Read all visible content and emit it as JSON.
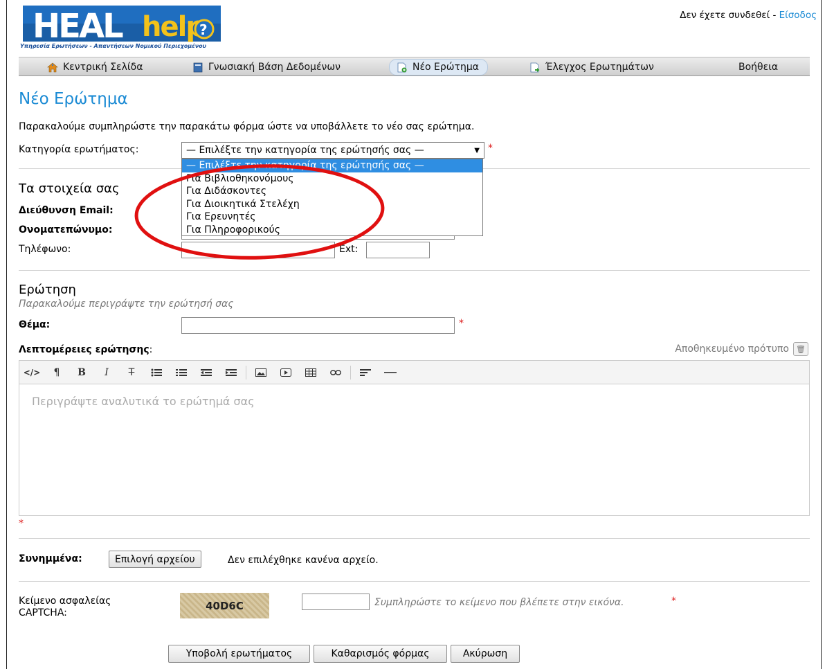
{
  "header": {
    "logo_text": "HEAL help",
    "logo_subtitle": "Υπηρεσία Ερωτήσεων - Απαντήσεων Νομικού Περιεχομένου",
    "login_status": "Δεν έχετε συνδεθεί - ",
    "login_link": "Είσοδος"
  },
  "nav": {
    "items": [
      {
        "label": "Κεντρική Σελίδα",
        "icon": "home-icon"
      },
      {
        "label": "Γνωσιακή Βάση Δεδομένων",
        "icon": "knowledge-base-icon"
      },
      {
        "label": "Νέο Ερώτημα",
        "icon": "new-ticket-icon",
        "active": true
      },
      {
        "label": "Έλεγχος Ερωτημάτων",
        "icon": "check-ticket-icon"
      },
      {
        "label": "Βοήθεια"
      }
    ]
  },
  "page": {
    "title": "Νέο Ερώτημα",
    "intro": "Παρακαλούμε συμπληρώστε την παρακάτω φόρμα ώστε να υποβάλλετε το νέο σας ερώτημα."
  },
  "category": {
    "label": "Κατηγορία ερωτήματος:",
    "selected": "— Επιλέξτε την κατηγορία της ερώτησής σας —",
    "options": [
      "— Επιλέξτε την κατηγορία της ερώτησής σας —",
      "Για Βιβλιοθηκονόμους",
      "Για Διδάσκοντες",
      "Για Διοικητικά Στελέχη",
      "Για Ερευνητές",
      "Για Πληροφορικούς"
    ],
    "required_mark": "*"
  },
  "contact": {
    "heading": "Τα στοιχεία σας",
    "email_label": "Διεύθυνση Email:",
    "name_label": "Ονοματεπώνυμο:",
    "phone_label": "Τηλέφωνο:",
    "ext_label": "Ext:",
    "email_value": "",
    "name_value": "",
    "phone_value": "",
    "ext_value": ""
  },
  "question": {
    "heading": "Ερώτηση",
    "hint": "Παρακαλούμε περιγράψτε την ερώτησή σας",
    "subject_label": "Θέμα:",
    "subject_value": "",
    "details_label": "Λεπτομέρειες ερώτησης",
    "details_label_suffix": ":",
    "saved_template": "Αποθηκευμένο πρότυπο",
    "editor_placeholder": "Περιγράψτε αναλυτικά το ερώτημά σας",
    "toolbar": [
      "</>",
      "¶",
      "B",
      "I",
      "T"
    ]
  },
  "attachments": {
    "label": "Συνημμένα:",
    "choose_button": "Επιλογή αρχείου",
    "status": "Δεν επιλέχθηκε κανένα αρχείο."
  },
  "captcha": {
    "label_line1": "Κείμενο ασφαλείας",
    "label_line2": "CAPTCHA:",
    "image_text": "40D6C",
    "hint": "Συμπληρώστε το κείμενο που βλέπετε στην εικόνα.",
    "value": ""
  },
  "actions": {
    "submit": "Υποβολή ερωτήματος",
    "reset": "Καθαρισμός φόρμας",
    "cancel": "Ακύρωση"
  },
  "colors": {
    "accent": "#1a8ad4",
    "required": "#dd2222",
    "annotation_circle": "#e01010"
  }
}
